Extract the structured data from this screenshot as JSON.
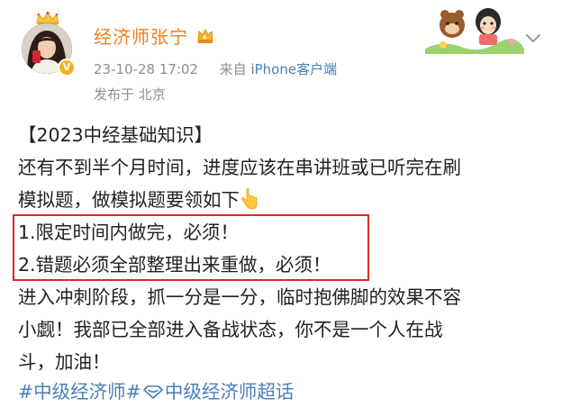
{
  "post": {
    "author": {
      "name": "经济师张宁",
      "vip_badge_icon": "vip-crown-badge-icon",
      "avatar_icon": "user-avatar",
      "verified_icon": "verified-v-icon"
    },
    "timestamp": "23-10-28 17:02",
    "source_prefix": "来自",
    "device": "iPhone客户端",
    "location_prefix": "发布于",
    "location": "北京",
    "content": {
      "line1": "【2023中经基础知识】",
      "line2": "还有不到半个月时间，进度应该在串讲班或已听完在刷",
      "line3": "模拟题，做模拟题要领如下",
      "line3_emoji": "backhand-index-pointing-down-icon",
      "line4": "1.限定时间内做完，必须！",
      "line5": "2.错题必须全部整理出来重做，必须！",
      "line6": "进入冲刺阶段，抓一分是一分，临时抱佛脚的效果不容",
      "line7": "小觑！我部已全部进入备战状态，你不是一个人在战",
      "line8": "斗，加油！"
    },
    "hashtags": {
      "tag1": "#中级经济师#",
      "supertopic_icon": "supertopic-diamond-icon",
      "tag2": "中级经济师超话"
    }
  },
  "colors": {
    "username": "#f07e1d",
    "link": "#4a7fb8",
    "meta": "#8e8e8e",
    "highlight_border": "#e0262a",
    "text": "#222222"
  }
}
